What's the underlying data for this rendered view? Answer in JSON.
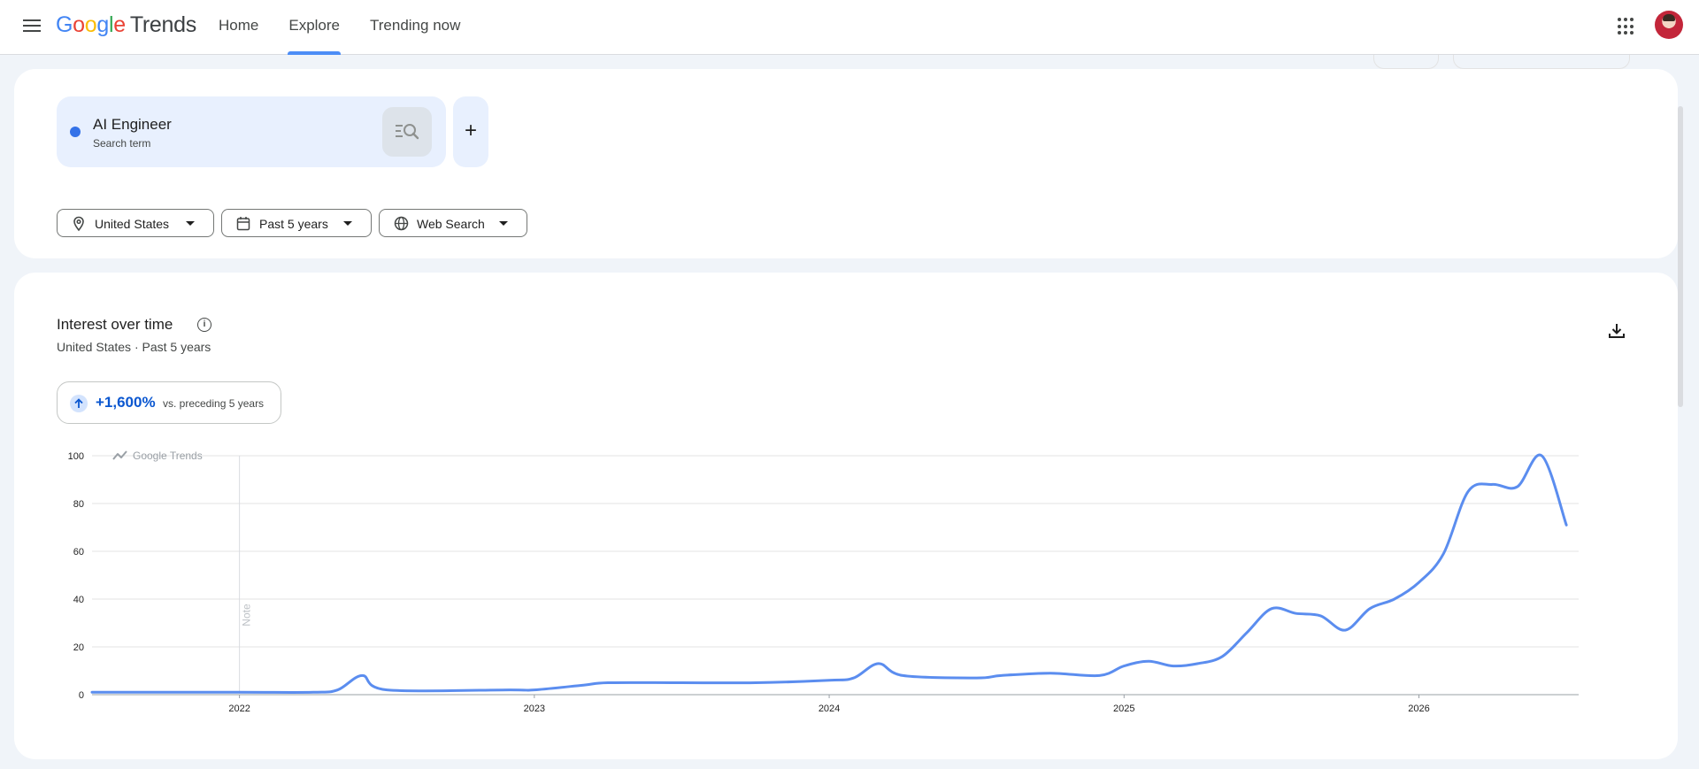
{
  "header": {
    "logo_text": "Google",
    "logo_product": "Trends",
    "logo_colors": [
      "#4285F4",
      "#EA4335",
      "#FBBC05",
      "#4285F4",
      "#34A853",
      "#EA4335"
    ],
    "nav_tabs": [
      {
        "label": "Home",
        "active": false
      },
      {
        "label": "Explore",
        "active": true
      },
      {
        "label": "Trending now",
        "active": false
      }
    ],
    "menu_icon": "hamburger-menu-icon",
    "apps_icon": "apps-grid-icon"
  },
  "search": {
    "term": "AI Engineer",
    "term_type": "Search term",
    "term_color": "#3472e8",
    "add_label": "+"
  },
  "filters": {
    "location": "United States",
    "time_range": "Past 5 years",
    "search_type": "Web Search"
  },
  "interest": {
    "title": "Interest over time",
    "subtitle": "United States · Past 5 years",
    "change_value": "+1,600%",
    "change_text": "vs. preceding 5 years"
  },
  "chart_data": {
    "type": "line",
    "series": [
      {
        "color": "#5b8def",
        "points": [
          [
            "2021-07",
            1
          ],
          [
            "2022-01",
            1
          ],
          [
            "2022-04",
            1
          ],
          [
            "2022-05",
            2
          ],
          [
            "2022-06",
            8
          ],
          [
            "2022-07",
            2
          ],
          [
            "2022-12",
            2
          ],
          [
            "2023-01",
            2
          ],
          [
            "2023-03",
            4
          ],
          [
            "2023-04",
            5
          ],
          [
            "2023-07",
            5
          ],
          [
            "2023-10",
            5
          ],
          [
            "2024-01",
            6
          ],
          [
            "2024-02",
            7
          ],
          [
            "2024-03",
            13
          ],
          [
            "2024-04",
            8
          ],
          [
            "2024-07",
            7
          ],
          [
            "2024-08",
            8
          ],
          [
            "2024-10",
            9
          ],
          [
            "2024-12",
            8
          ],
          [
            "2025-01",
            12
          ],
          [
            "2025-02",
            14
          ],
          [
            "2025-03",
            12
          ],
          [
            "2025-04",
            13
          ],
          [
            "2025-05",
            16
          ],
          [
            "2025-06",
            26
          ],
          [
            "2025-07",
            36
          ],
          [
            "2025-08",
            34
          ],
          [
            "2025-09",
            33
          ],
          [
            "2025-10",
            27
          ],
          [
            "2025-11",
            36
          ],
          [
            "2025-12",
            40
          ],
          [
            "2026-01",
            47
          ],
          [
            "2026-02",
            59
          ],
          [
            "2026-03",
            85
          ],
          [
            "2026-04",
            88
          ],
          [
            "2026-05",
            87
          ],
          [
            "2026-06",
            100
          ],
          [
            "2026-07",
            71
          ]
        ]
      }
    ],
    "x_ticks": [
      "2022",
      "2023",
      "2024",
      "2025",
      "2026"
    ],
    "y_ticks": [
      0,
      20,
      40,
      60,
      80,
      100
    ],
    "ylim": [
      0,
      100
    ],
    "grid": true,
    "annotation": "Note",
    "watermark": "Google Trends"
  }
}
